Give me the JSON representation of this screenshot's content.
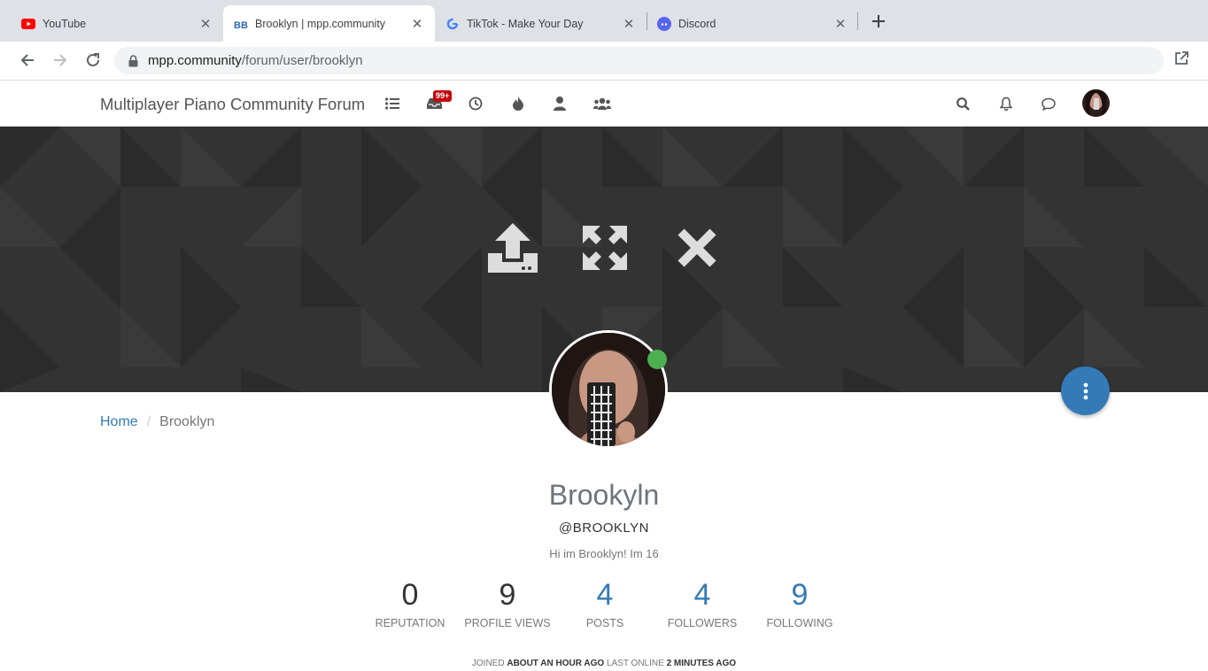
{
  "browser": {
    "tabs": [
      {
        "title": "YouTube",
        "icon": "youtube-icon"
      },
      {
        "title": "Brooklyn | mpp.community",
        "icon": "nodebb-icon",
        "active": true
      },
      {
        "title": "TikTok - Make Your Day",
        "icon": "google-icon"
      },
      {
        "title": "Discord",
        "icon": "discord-icon"
      }
    ],
    "url_host": "mpp.community",
    "url_path": "/forum/user/brooklyn"
  },
  "forum": {
    "brand": "Multiplayer Piano Community Forum",
    "unread_badge": "99+"
  },
  "breadcrumb": {
    "home": "Home",
    "current": "Brooklyn"
  },
  "profile": {
    "fullname": "Brookyln",
    "username": "@BROOKLYN",
    "aboutme": "Hi im Brooklyn! Im 16",
    "online": true,
    "stats": [
      {
        "value": "0",
        "label": "REPUTATION"
      },
      {
        "value": "9",
        "label": "PROFILE VIEWS"
      },
      {
        "value": "4",
        "label": "POSTS"
      },
      {
        "value": "4",
        "label": "FOLLOWERS"
      },
      {
        "value": "9",
        "label": "FOLLOWING"
      }
    ],
    "joined_label": "JOINED",
    "joined_value": "ABOUT AN HOUR AGO",
    "lastonline_label": "LAST ONLINE",
    "lastonline_value": "2 MINUTES AGO"
  },
  "colors": {
    "link": "#337ab7",
    "badge": "#c3060e",
    "online": "#4caf50",
    "cover": "#333333"
  }
}
